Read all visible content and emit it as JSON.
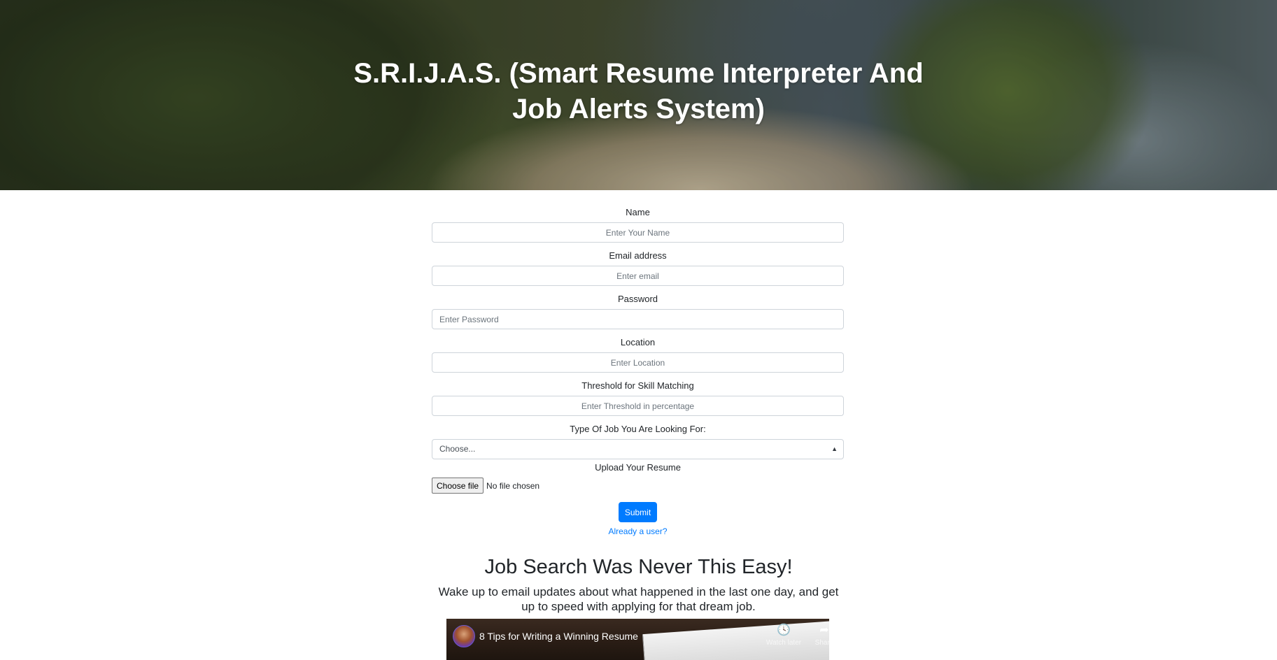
{
  "header": {
    "title": "S.R.I.J.A.S. (Smart Resume Interpreter And Job Alerts System)"
  },
  "form": {
    "name": {
      "label": "Name",
      "placeholder": "Enter Your Name"
    },
    "email": {
      "label": "Email address",
      "placeholder": "Enter email"
    },
    "password": {
      "label": "Password",
      "placeholder": "Enter Password"
    },
    "location": {
      "label": "Location",
      "placeholder": "Enter Location"
    },
    "threshold": {
      "label": "Threshold for Skill Matching",
      "placeholder": "Enter Threshold in percentage"
    },
    "job_type": {
      "label": "Type Of Job You Are Looking For:",
      "selected": "Choose..."
    },
    "resume": {
      "label": "Upload Your Resume",
      "button": "Choose file",
      "status": "No file chosen"
    },
    "submit_label": "Submit",
    "login_link": "Already a user?"
  },
  "promo": {
    "heading": "Job Search Was Never This Easy!",
    "text": "Wake up to email updates about what happened in the last one day, and get up to speed with applying for that dream job."
  },
  "video": {
    "title": "8 Tips for Writing a Winning Resume",
    "watch_later": "Watch later",
    "share": "Share",
    "icons": {
      "watch_later": "clock-icon",
      "share": "share-icon"
    }
  },
  "colors": {
    "primary": "#007bff",
    "text": "#212529",
    "input_border": "#ced4da"
  }
}
